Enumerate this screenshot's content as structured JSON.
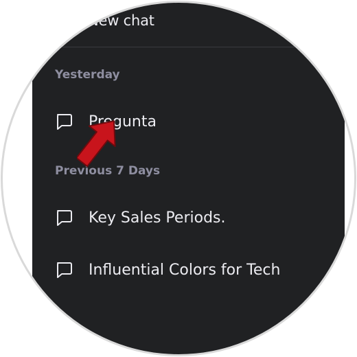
{
  "sidebar": {
    "new_chat_label": "New chat",
    "sections": [
      {
        "label": "Yesterday",
        "items": [
          {
            "label": "Pregunta",
            "icon": "chat-bubble-icon"
          }
        ]
      },
      {
        "label": "Previous 7 Days",
        "items": [
          {
            "label": "Key Sales Periods.",
            "icon": "chat-bubble-icon"
          },
          {
            "label": "Influential Colors for Tech",
            "icon": "chat-bubble-icon"
          }
        ]
      }
    ]
  },
  "colors": {
    "sidebar_bg": "#202123",
    "text": "#ececf1",
    "muted_text": "#8e8ea0",
    "arrow": "#c8141c",
    "frame_border": "#d9d9d9"
  },
  "annotation": {
    "icon": "red-pointer-arrow-icon"
  }
}
